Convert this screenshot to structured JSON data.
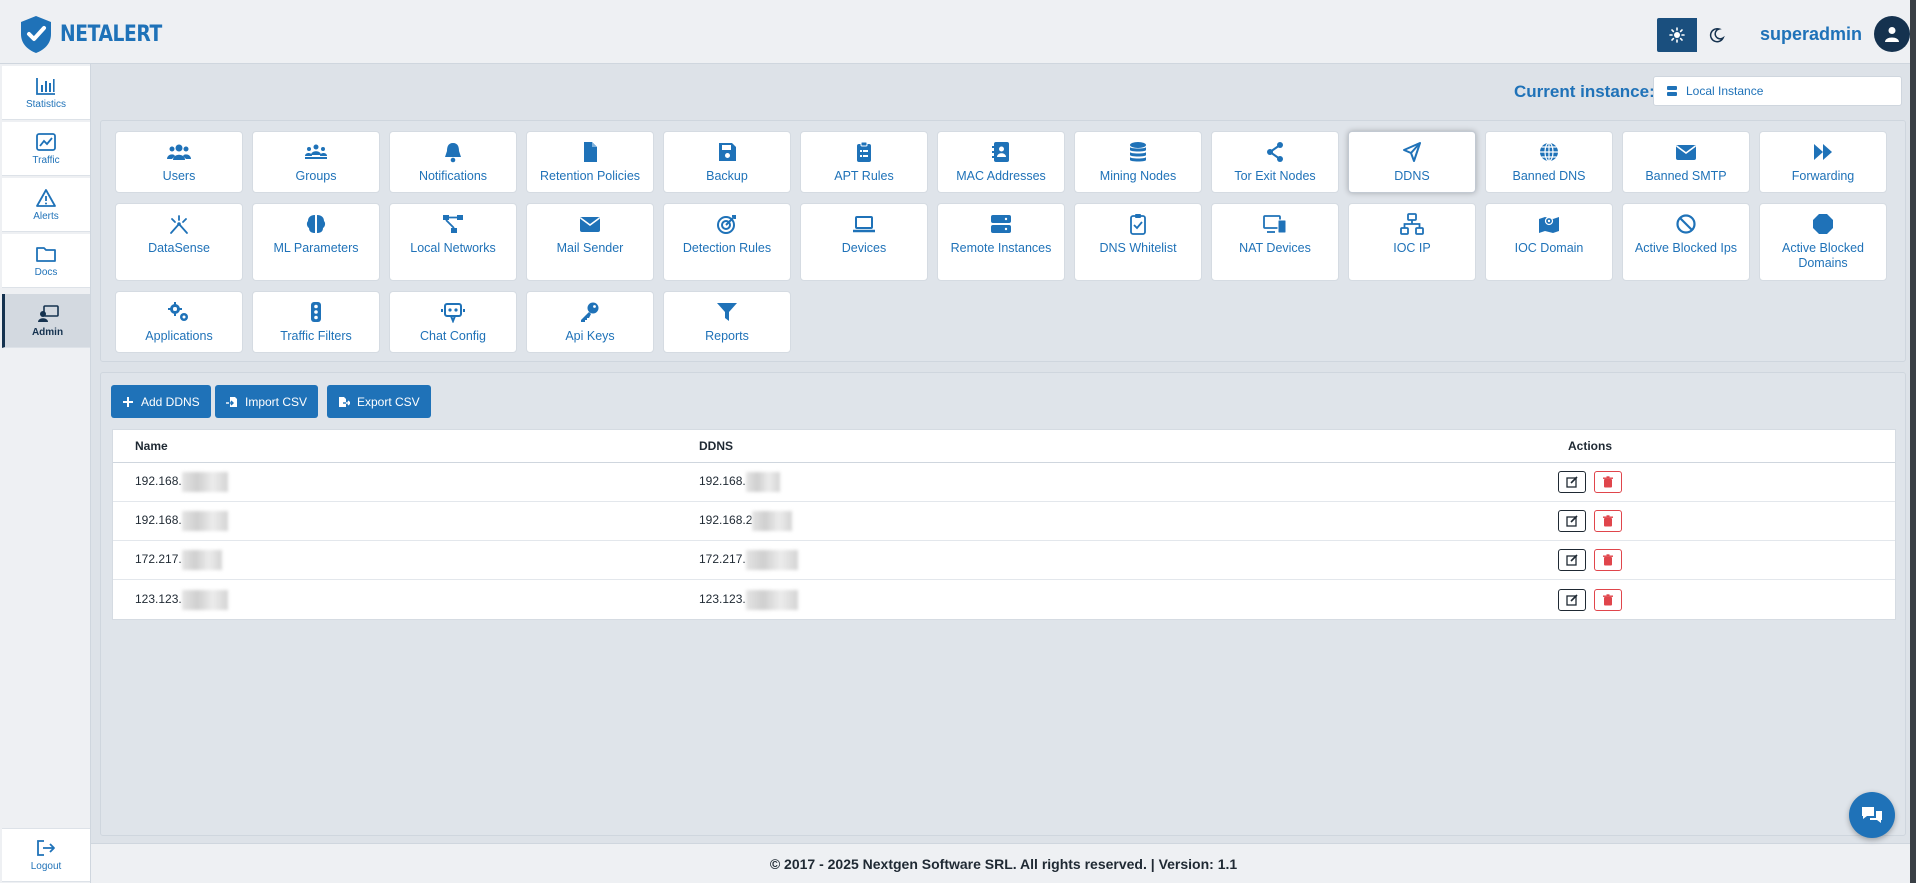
{
  "app": {
    "brand": "NETALERT",
    "colors": {
      "primary": "#1f72b8",
      "dark": "#15324f",
      "danger": "#e0454b"
    }
  },
  "header": {
    "username": "superadmin",
    "theme_light_icon": "sun-icon",
    "theme_dark_icon": "moon-icon"
  },
  "sidebar": {
    "items": [
      {
        "label": "Statistics",
        "icon": "bar-chart-icon"
      },
      {
        "label": "Traffic",
        "icon": "line-chart-icon"
      },
      {
        "label": "Alerts",
        "icon": "warning-icon"
      },
      {
        "label": "Docs",
        "icon": "folder-icon"
      },
      {
        "label": "Admin",
        "icon": "admin-icon",
        "active": true
      }
    ],
    "logout": "Logout"
  },
  "instance": {
    "label": "Current instance:",
    "value": "Local Instance"
  },
  "tiles": [
    {
      "label": "Users",
      "icon": "users-icon"
    },
    {
      "label": "Groups",
      "icon": "groups-icon"
    },
    {
      "label": "Notifications",
      "icon": "bell-icon"
    },
    {
      "label": "Retention Policies",
      "icon": "file-icon"
    },
    {
      "label": "Backup",
      "icon": "save-icon"
    },
    {
      "label": "APT Rules",
      "icon": "clipboard-icon"
    },
    {
      "label": "MAC Addresses",
      "icon": "address-book-icon"
    },
    {
      "label": "Mining Nodes",
      "icon": "coins-icon"
    },
    {
      "label": "Tor Exit Nodes",
      "icon": "share-icon"
    },
    {
      "label": "DDNS",
      "icon": "send-icon",
      "selected": true
    },
    {
      "label": "Banned DNS",
      "icon": "globe-icon"
    },
    {
      "label": "Banned SMTP",
      "icon": "envelope-icon"
    },
    {
      "label": "Forwarding",
      "icon": "forward-icon"
    },
    {
      "label": "DataSense",
      "icon": "wand-icon"
    },
    {
      "label": "ML Parameters",
      "icon": "brain-icon"
    },
    {
      "label": "Local Networks",
      "icon": "network-icon"
    },
    {
      "label": "Mail Sender",
      "icon": "envelope-icon"
    },
    {
      "label": "Detection Rules",
      "icon": "target-icon"
    },
    {
      "label": "Devices",
      "icon": "laptop-icon"
    },
    {
      "label": "Remote Instances",
      "icon": "server-icon"
    },
    {
      "label": "DNS Whitelist",
      "icon": "clipboard-check-icon"
    },
    {
      "label": "NAT Devices",
      "icon": "devices-icon"
    },
    {
      "label": "IOC IP",
      "icon": "sitemap-icon"
    },
    {
      "label": "IOC Domain",
      "icon": "map-icon"
    },
    {
      "label": "Active Blocked Ips",
      "icon": "ban-icon"
    },
    {
      "label": "Active Blocked Domains",
      "icon": "octagon-icon"
    },
    {
      "label": "Applications",
      "icon": "gears-icon"
    },
    {
      "label": "Traffic Filters",
      "icon": "traffic-light-icon"
    },
    {
      "label": "Chat Config",
      "icon": "robot-icon"
    },
    {
      "label": "Api Keys",
      "icon": "key-icon"
    },
    {
      "label": "Reports",
      "icon": "filter-icon"
    }
  ],
  "toolbar": {
    "add": "Add DDNS",
    "import": "Import CSV",
    "export": "Export CSV"
  },
  "table": {
    "headers": [
      "Name",
      "DDNS",
      "Actions"
    ],
    "rows": [
      {
        "name": "192.168.",
        "ddns": "192.168."
      },
      {
        "name": "192.168.",
        "ddns": "192.168.2"
      },
      {
        "name": "172.217.",
        "ddns": "172.217."
      },
      {
        "name": "123.123.",
        "ddns": "123.123."
      }
    ]
  },
  "footer": {
    "text": "© 2017 - 2025 Nextgen Software SRL. All rights reserved. | Version: 1.1"
  }
}
